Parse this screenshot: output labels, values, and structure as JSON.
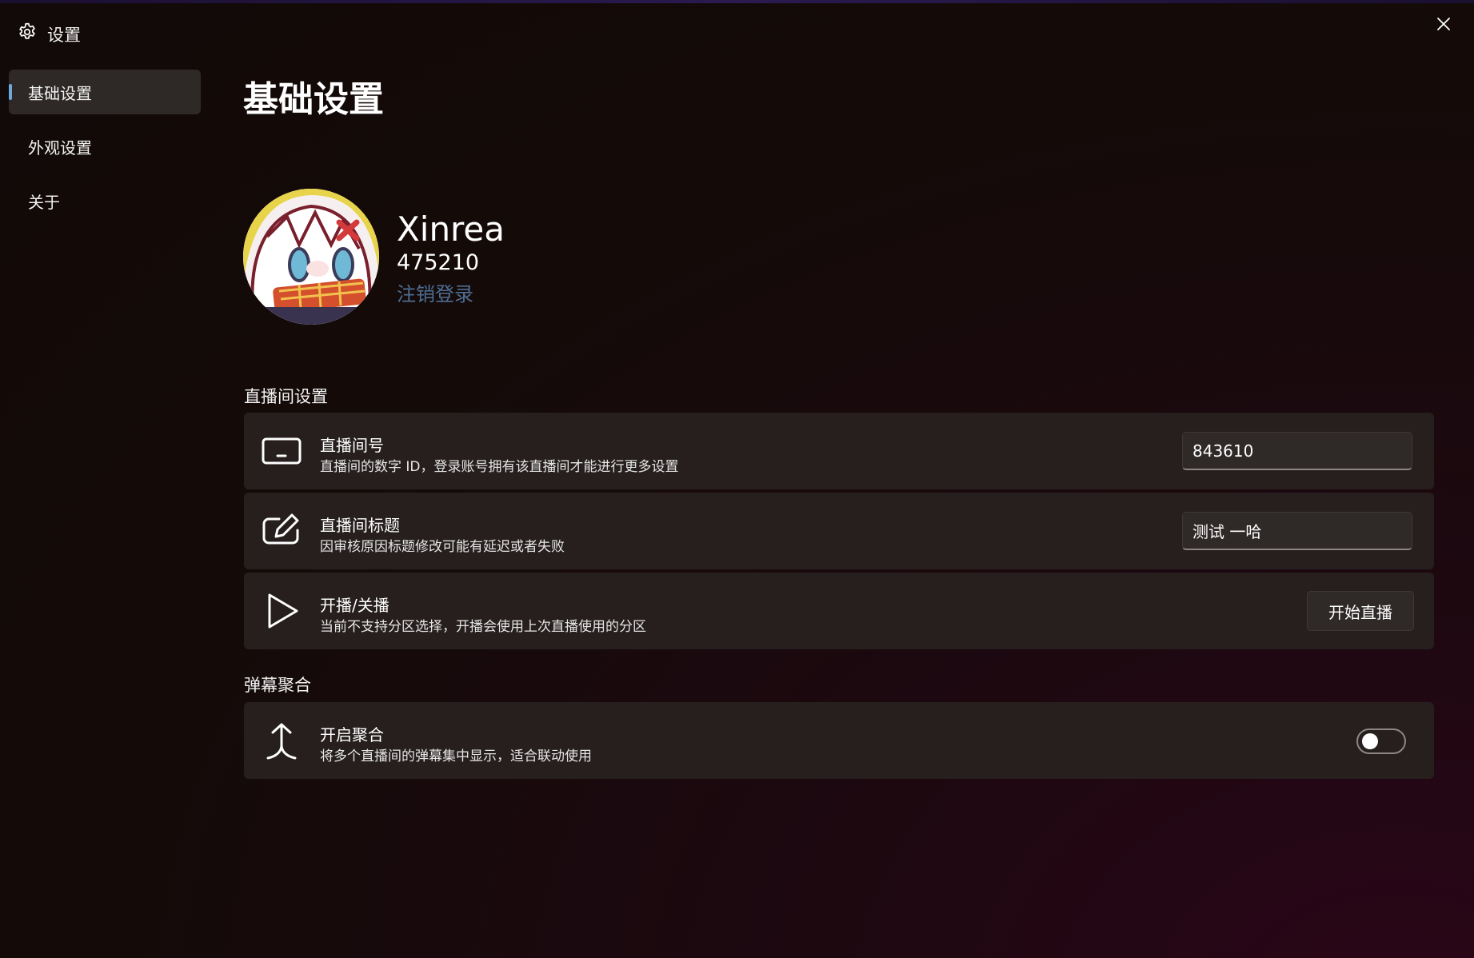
{
  "window": {
    "title": "设置",
    "title_icon": "gear-icon",
    "close_icon": "close-icon"
  },
  "sidebar": {
    "items": [
      {
        "label": "基础设置",
        "active": true
      },
      {
        "label": "外观设置",
        "active": false
      },
      {
        "label": "关于",
        "active": false
      }
    ]
  },
  "main": {
    "page_title": "基础设置",
    "profile": {
      "name": "Xinrea",
      "uid": "475210",
      "logout_label": "注销登录"
    },
    "live_section": {
      "title": "直播间设置",
      "room_id": {
        "icon": "keyboard-icon",
        "label": "直播间号",
        "description": "直播间的数字 ID，登录账号拥有该直播间才能进行更多设置",
        "value": "843610"
      },
      "room_title": {
        "icon": "edit-icon",
        "label": "直播间标题",
        "description": "因审核原因标题修改可能有延迟或者失败",
        "value": "测试 一哈"
      },
      "live_toggle": {
        "icon": "play-icon",
        "label": "开播/关播",
        "description": "当前不支持分区选择，开播会使用上次直播使用的分区",
        "button_label": "开始直播"
      }
    },
    "danmaku_section": {
      "title": "弹幕聚合",
      "merge": {
        "icon": "merge-arrow-icon",
        "label": "开启聚合",
        "description": "将多个直播间的弹幕集中显示，适合联动使用",
        "enabled": false
      }
    }
  },
  "colors": {
    "background": "#140b09",
    "card": "#261f1e",
    "accent": "#6fa8dc",
    "link": "#4f6d93"
  }
}
